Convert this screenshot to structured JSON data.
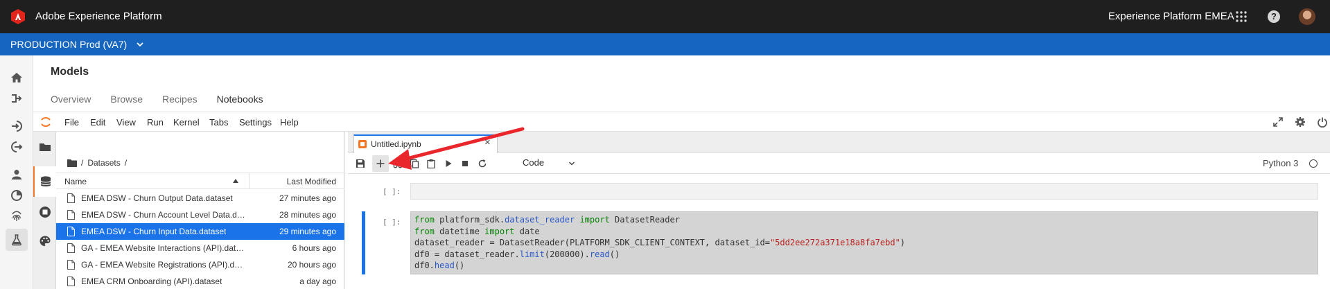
{
  "header": {
    "app_title": "Adobe Experience Platform",
    "org_name": "Experience Platform EMEA",
    "logo_icon": "adobe-logo",
    "apps_icon": "apps-grid-icon",
    "help_icon": "help-icon",
    "help_glyph": "?"
  },
  "environment": {
    "label": "PRODUCTION",
    "sandbox": "Prod (VA7)"
  },
  "page": {
    "title": "Models",
    "tabs": [
      {
        "label": "Overview"
      },
      {
        "label": "Browse"
      },
      {
        "label": "Recipes"
      },
      {
        "label": "Notebooks"
      }
    ],
    "active_tab": "Notebooks"
  },
  "jupyter_menu": [
    "File",
    "Edit",
    "View",
    "Run",
    "Kernel",
    "Tabs",
    "Settings",
    "Help"
  ],
  "filebrowser": {
    "path_sep": "/",
    "path_folder": "Datasets",
    "col_name": "Name",
    "col_modified": "Last Modified",
    "files": [
      {
        "name": "EMEA DSW - Churn Output Data.dataset",
        "modified": "27 minutes ago"
      },
      {
        "name": "EMEA DSW - Churn Account Level Data.dataset",
        "modified": "28 minutes ago"
      },
      {
        "name": "EMEA DSW - Churn Input Data.dataset",
        "modified": "29 minutes ago"
      },
      {
        "name": "GA - EMEA Website Interactions (API).dataset",
        "modified": "6 hours ago"
      },
      {
        "name": "GA - EMEA Website Registrations (API).dataset",
        "modified": "20 hours ago"
      },
      {
        "name": "EMEA CRM Onboarding (API).dataset",
        "modified": "a day ago"
      }
    ],
    "selected_index": 2
  },
  "notebook": {
    "tab_title": "Untitled.ipynb",
    "close_glyph": "×",
    "cell_type": "Code",
    "kernel": "Python 3",
    "cells": [
      {
        "prompt": "[ ]:",
        "code": []
      },
      {
        "prompt": "[ ]:",
        "code": [
          "from platform_sdk.dataset_reader import DatasetReader",
          "from datetime import date",
          "dataset_reader = DatasetReader(PLATFORM_SDK_CLIENT_CONTEXT, dataset_id=\"5dd2ee272a371e18a8fa7ebd\")",
          "df0 = dataset_reader.limit(200000).read()",
          "df0.head()"
        ]
      }
    ]
  },
  "colors": {
    "topbar": "#1f1f1f",
    "envbar": "#1666c0",
    "selection": "#1a73e8",
    "jupyter_orange": "#f37726",
    "annotation_arrow": "#e8262b"
  }
}
